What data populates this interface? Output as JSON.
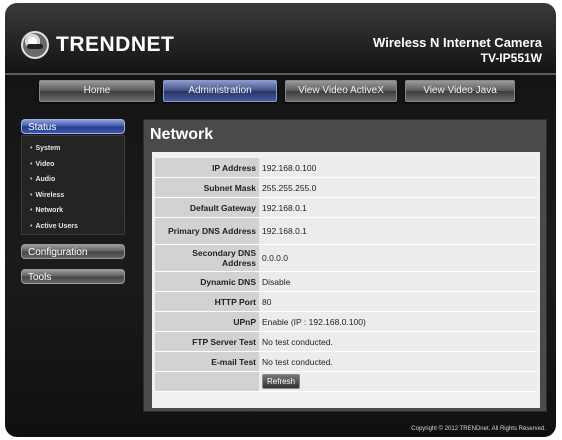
{
  "brand": {
    "logo_text": "TRENDNET"
  },
  "product": {
    "name": "Wireless N Internet Camera",
    "model": "TV-IP551W"
  },
  "nav": {
    "home": "Home",
    "administration": "Administration",
    "view_activex": "View Video   ActiveX",
    "view_java": "View Video   Java"
  },
  "sidebar": {
    "status": "Status",
    "items": [
      "System",
      "Video",
      "Audio",
      "Wireless",
      "Network",
      "Active Users"
    ],
    "configuration": "Configuration",
    "tools": "Tools"
  },
  "page": {
    "title": "Network",
    "rows": [
      {
        "label": "IP Address",
        "value": "192.168.0.100"
      },
      {
        "label": "Subnet Mask",
        "value": "255.255.255.0"
      },
      {
        "label": "Default Gateway",
        "value": "192.168.0.1"
      },
      {
        "label": "Primary DNS Address",
        "value": "192.168.0.1"
      },
      {
        "label": "Secondary DNS Address",
        "value": "0.0.0.0"
      },
      {
        "label": "Dynamic DNS",
        "value": "Disable"
      },
      {
        "label": "HTTP Port",
        "value": "80"
      },
      {
        "label": "UPnP",
        "value": "Enable (IP : 192.168.0.100)"
      },
      {
        "label": "FTP Server Test",
        "value": "No test conducted."
      },
      {
        "label": "E-mail Test",
        "value": "No test conducted."
      }
    ],
    "refresh": "Refresh"
  },
  "footer": "Copyright © 2012 TRENDnet.  All Rights Reserved."
}
